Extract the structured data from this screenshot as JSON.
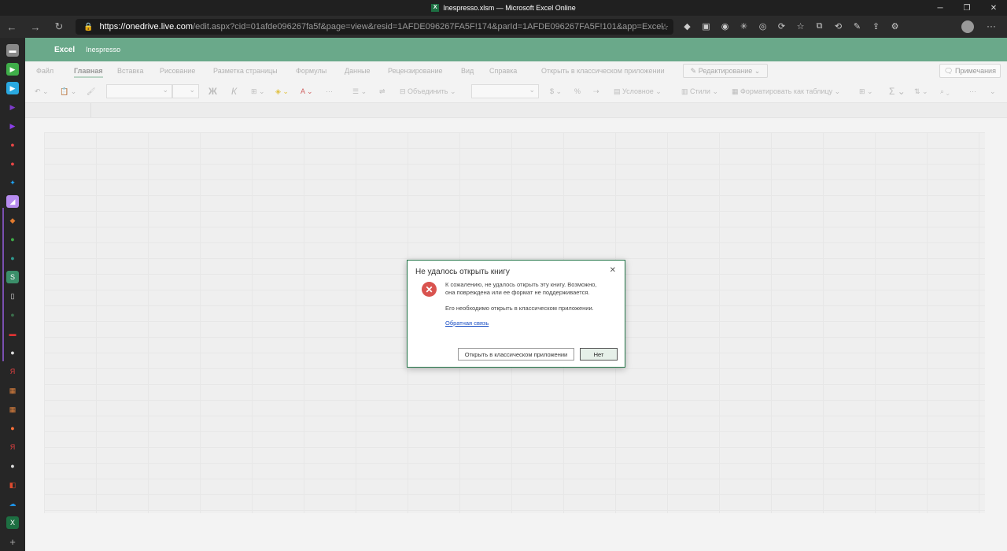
{
  "window": {
    "title": "Inespresso.xlsm — Microsoft Excel Online",
    "controls": [
      "─",
      "❐",
      "✕"
    ]
  },
  "browser": {
    "url_host": "https://onedrive.live.com",
    "url_path": "/edit.aspx?cid=01afde096267fa5f&page=view&resid=1AFDE096267FA5F!174&parId=1AFDE096267FA5F!101&app=Excel"
  },
  "app": {
    "name": "Excel",
    "document": "Inespresso"
  },
  "ribbon": {
    "tabs": [
      "Файл",
      "Главная",
      "Вставка",
      "Рисование",
      "Разметка страницы",
      "Формулы",
      "Данные",
      "Рецензирование",
      "Вид",
      "Справка",
      "Открыть в классическом приложении"
    ],
    "active_tab": "Главная",
    "edit_mode": "Редактирование",
    "comments": "Примечания",
    "toolbar": {
      "bold": "Ж",
      "italic": "К",
      "merge": "Объединить",
      "currency": "$",
      "conditional": "Условное",
      "styles": "Стили",
      "format_table": "Форматировать как таблицу",
      "sum": "Σ",
      "more": "···"
    }
  },
  "dialog": {
    "title": "Не удалось открыть книгу",
    "close": "✕",
    "message_line1": "К сожалению, не удалось открыть эту книгу. Возможно,",
    "message_line2": "она повреждена или ее формат не поддерживается.",
    "message2": "Его необходимо открыть в классическом приложении.",
    "feedback_link": "Обратная связь",
    "open_button": "Открыть в классическом приложении",
    "no_button": "Нет",
    "icon": "error-icon"
  },
  "colors": {
    "excel_green": "#217346",
    "appbar": "#6aa98a",
    "error_red": "#d9534f"
  }
}
